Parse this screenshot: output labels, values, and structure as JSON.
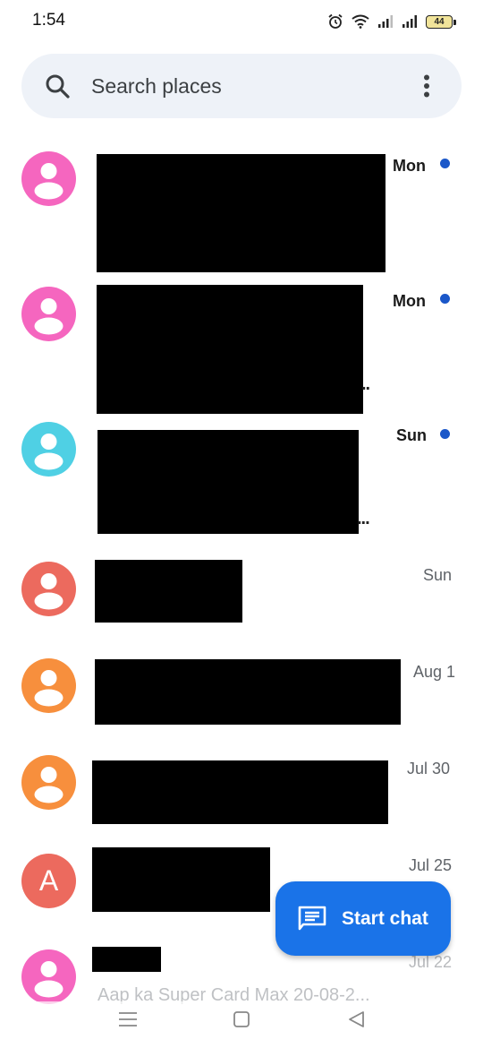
{
  "status_bar": {
    "time": "1:54",
    "battery": "44"
  },
  "search": {
    "placeholder": "Search places"
  },
  "conversations": [
    {
      "date": "Mon",
      "avatar_color": "#f566bf",
      "unread": true
    },
    {
      "date": "Mon",
      "avatar_color": "#f566bf",
      "unread": true
    },
    {
      "date": "Sun",
      "avatar_color": "#4fd0e4",
      "unread": true
    },
    {
      "date": "Sun",
      "avatar_color": "#ec6a5e",
      "unread": false
    },
    {
      "date": "Aug 1",
      "avatar_color": "#f78f3d",
      "unread": false
    },
    {
      "date": "Jul 30",
      "avatar_color": "#f78f3d",
      "unread": false
    },
    {
      "date": "Jul 25",
      "avatar_color": "#ec6a5e",
      "unread": false,
      "avatar_letter": "A"
    },
    {
      "date": "Jul 22",
      "avatar_color": "#f566bf",
      "unread": false,
      "preview": "Aap ka Super Card Max 20-08-2..."
    }
  ],
  "fab": {
    "label": "Start chat"
  },
  "colors": {
    "accent": "#1a73e8",
    "unread_dot": "#1a57c9",
    "search_bg": "#eef2f8"
  }
}
